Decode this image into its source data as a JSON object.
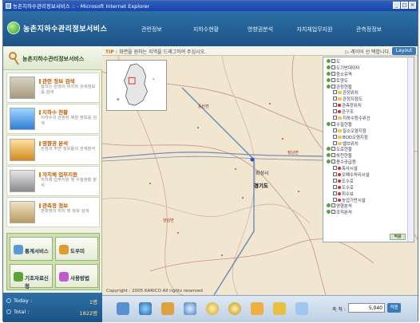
{
  "window": {
    "title": "농촌지하수관리정보서비스 :: - Microsoft Internet Explorer"
  },
  "header": {
    "logo": "농촌지하수관리정보서비스",
    "menu": [
      "관련정보",
      "지하수현황",
      "영향권분석",
      "자치체업무지원",
      "관측정정보"
    ]
  },
  "infobar": {
    "tip_label": "TIP :",
    "tip": "화면을 원하는 지역을 드래그하여 주십시오.",
    "select": "▷ 레이어 선 택합니다.",
    "layout": "Layout"
  },
  "sidebar": {
    "title": "농촌지하수관리정보서비스",
    "items": [
      {
        "title": "관련 정보 검색",
        "desc": "질의는 관정의 위치와 상세정보를 검색"
      },
      {
        "title": "지하수 현황",
        "desc": "지하수의 관정된 제원 정보를 검색"
      },
      {
        "title": "영향권 분석",
        "desc": "관정과 주변 정보들의 관계분석"
      },
      {
        "title": "자치체 업무지원",
        "desc": "자치체 업무지원 및 수질현황 분석"
      },
      {
        "title": "관측정 정보",
        "desc": "관측정의 위치 및 정보 검색"
      }
    ],
    "quick": [
      "통계서비스",
      "도우미",
      "기초자료신청",
      "사용방법"
    ],
    "counter": [
      {
        "label": "Today :",
        "value": "1명"
      },
      {
        "label": "Total :",
        "value": "1822명"
      }
    ]
  },
  "map": {
    "labels": [
      "동탄면",
      "화성시",
      "경기도",
      "양감면",
      "정남면"
    ],
    "copyright": "Copyright : 2005 KARICO All rights reserved"
  },
  "layers": {
    "nodes": [
      {
        "label": "도",
        "indent": 1,
        "kind": "cb"
      },
      {
        "label": "도기반데이터",
        "indent": 1,
        "kind": "cb"
      },
      {
        "label": "중소유역",
        "indent": 1,
        "kind": "cb"
      },
      {
        "label": "토양도",
        "indent": 1,
        "kind": "cb"
      },
      {
        "label": "관정현황",
        "indent": 1,
        "kind": "cb"
      },
      {
        "label": "관정위치",
        "indent": 2,
        "kind": "fd"
      },
      {
        "label": "관정지점도",
        "indent": 2,
        "kind": "fd"
      },
      {
        "label": "관측정위치",
        "indent": 2,
        "kind": "dt",
        "color": "#d03030"
      },
      {
        "label": "관구조",
        "indent": 2,
        "kind": "dt",
        "color": "#d03030"
      },
      {
        "label": "지하수등수위선",
        "indent": 2,
        "kind": "fd"
      },
      {
        "label": "수질현황",
        "indent": 1,
        "kind": "cb"
      },
      {
        "label": "질소오염지점",
        "indent": 2,
        "kind": "fd"
      },
      {
        "label": "BOD오염지점",
        "indent": 2,
        "kind": "fd"
      },
      {
        "label": "밸브위치",
        "indent": 2,
        "kind": "fd"
      },
      {
        "label": "도로현황",
        "indent": 1,
        "kind": "cb"
      },
      {
        "label": "하천현황",
        "indent": 1,
        "kind": "cb"
      },
      {
        "label": "용수공급원",
        "indent": 1,
        "kind": "cb"
      },
      {
        "label": "축사시설",
        "indent": 2,
        "kind": "dt",
        "color": "#d03030"
      },
      {
        "label": "오폐수처리시설",
        "indent": 2,
        "kind": "dt",
        "color": "#d03030"
      },
      {
        "label": "도수로",
        "indent": 2,
        "kind": "dt",
        "color": "#d03030"
      },
      {
        "label": "도수로",
        "indent": 2,
        "kind": "dt",
        "color": "#d03030"
      },
      {
        "label": "취수보",
        "indent": 2,
        "kind": "dt",
        "color": "#d03030"
      },
      {
        "label": "농업기반시설",
        "indent": 2,
        "kind": "dt",
        "color": "#d03030"
      },
      {
        "label": "영향분석",
        "indent": 1,
        "kind": "cb"
      },
      {
        "label": "조직분석",
        "indent": 1,
        "kind": "cb"
      }
    ],
    "apply": "적용"
  },
  "toolbar": {
    "scale_label": "축 척 :",
    "scale_value": "5,040",
    "scale_btn": "적용"
  }
}
